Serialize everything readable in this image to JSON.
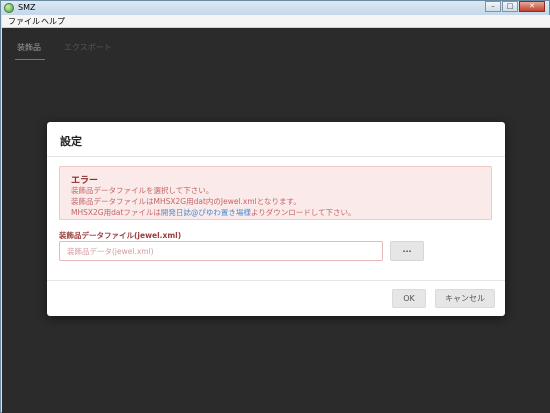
{
  "window": {
    "title": "SMZ"
  },
  "menu": {
    "items": [
      "ファイル",
      "ヘルプ"
    ]
  },
  "tabs": [
    "装飾品",
    "エクスポート"
  ],
  "dialog": {
    "title": "設定",
    "alert": {
      "title": "エラー",
      "line1": "装飾品データファイルを選択して下さい。",
      "line2": "装飾品データファイルはMHSX2G用dat内のJewel.xmlとなります。",
      "line3_before": "MHSX2G用datファイルは",
      "line3_link": "開発日誌@ぴゆわ置き場様",
      "line3_after": "よりダウンロードして下さい。"
    },
    "field_label": "装飾品データファイル(jewel.xml)",
    "field_placeholder": "装飾品データ(jewel.xml)",
    "field_value": "",
    "browse_label": "...",
    "ok_label": "OK",
    "cancel_label": "キャンセル"
  },
  "colors": {
    "error_text": "#c36565",
    "alert_bg": "#fbeaea",
    "link": "#4a8fd0",
    "backdrop": "#2b2b2b"
  }
}
